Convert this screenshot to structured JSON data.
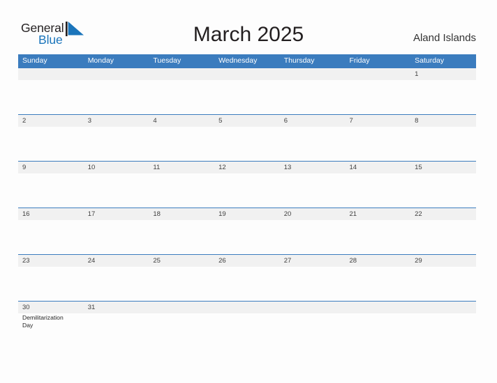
{
  "brand": {
    "name_top": "General",
    "name_bottom": "Blue",
    "sail_icon": "sail-triangle-icon",
    "color_dark": "#231f20",
    "color_blue": "#1b75bb"
  },
  "header": {
    "title": "March 2025",
    "region": "Aland Islands"
  },
  "theme": {
    "header_blue": "#3b7cbe",
    "row_band_gray": "#f1f1f1",
    "page_background": "#fdfdfd",
    "day_number_color": "#404040",
    "event_text_color": "#262626"
  },
  "calendar": {
    "month": "March",
    "year": "2025",
    "day_names": [
      "Sunday",
      "Monday",
      "Tuesday",
      "Wednesday",
      "Thursday",
      "Friday",
      "Saturday"
    ],
    "weeks": [
      {
        "days": [
          {
            "num": "",
            "events": []
          },
          {
            "num": "",
            "events": []
          },
          {
            "num": "",
            "events": []
          },
          {
            "num": "",
            "events": []
          },
          {
            "num": "",
            "events": []
          },
          {
            "num": "",
            "events": []
          },
          {
            "num": "1",
            "events": []
          }
        ]
      },
      {
        "days": [
          {
            "num": "2",
            "events": []
          },
          {
            "num": "3",
            "events": []
          },
          {
            "num": "4",
            "events": []
          },
          {
            "num": "5",
            "events": []
          },
          {
            "num": "6",
            "events": []
          },
          {
            "num": "7",
            "events": []
          },
          {
            "num": "8",
            "events": []
          }
        ]
      },
      {
        "days": [
          {
            "num": "9",
            "events": []
          },
          {
            "num": "10",
            "events": []
          },
          {
            "num": "11",
            "events": []
          },
          {
            "num": "12",
            "events": []
          },
          {
            "num": "13",
            "events": []
          },
          {
            "num": "14",
            "events": []
          },
          {
            "num": "15",
            "events": []
          }
        ]
      },
      {
        "days": [
          {
            "num": "16",
            "events": []
          },
          {
            "num": "17",
            "events": []
          },
          {
            "num": "18",
            "events": []
          },
          {
            "num": "19",
            "events": []
          },
          {
            "num": "20",
            "events": []
          },
          {
            "num": "21",
            "events": []
          },
          {
            "num": "22",
            "events": []
          }
        ]
      },
      {
        "days": [
          {
            "num": "23",
            "events": []
          },
          {
            "num": "24",
            "events": []
          },
          {
            "num": "25",
            "events": []
          },
          {
            "num": "26",
            "events": []
          },
          {
            "num": "27",
            "events": []
          },
          {
            "num": "28",
            "events": []
          },
          {
            "num": "29",
            "events": []
          }
        ]
      },
      {
        "days": [
          {
            "num": "30",
            "events": [
              "Demilitarization Day"
            ]
          },
          {
            "num": "31",
            "events": []
          },
          {
            "num": "",
            "events": []
          },
          {
            "num": "",
            "events": []
          },
          {
            "num": "",
            "events": []
          },
          {
            "num": "",
            "events": []
          },
          {
            "num": "",
            "events": []
          }
        ]
      }
    ]
  }
}
